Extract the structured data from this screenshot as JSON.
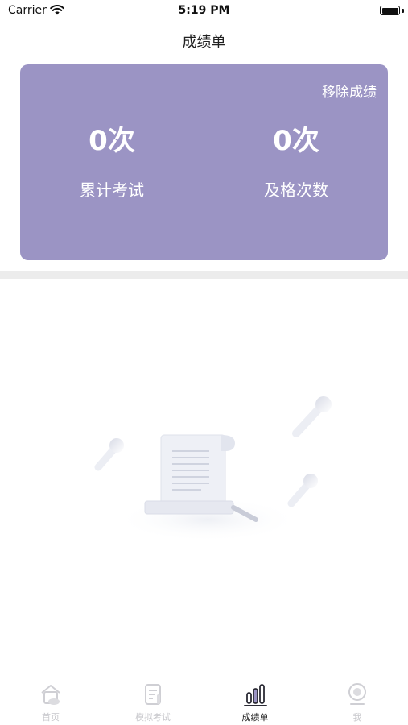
{
  "status_bar": {
    "carrier": "Carrier",
    "time": "5:19 PM"
  },
  "nav": {
    "title": "成绩单"
  },
  "score_card": {
    "background": "#9b94c4",
    "remove_label": "移除成绩",
    "stats": [
      {
        "value": "0次",
        "label": "累计考试"
      },
      {
        "value": "0次",
        "label": "及格次数"
      }
    ]
  },
  "empty_state": {
    "icon": "document-scroll-illustration"
  },
  "tab_bar": {
    "tabs": [
      {
        "label": "首页",
        "icon": "home-icon",
        "active": false
      },
      {
        "label": "模拟考试",
        "icon": "exam-paper-icon",
        "active": false
      },
      {
        "label": "成绩单",
        "icon": "bar-chart-icon",
        "active": true
      },
      {
        "label": "我",
        "icon": "profile-icon",
        "active": false
      }
    ]
  }
}
